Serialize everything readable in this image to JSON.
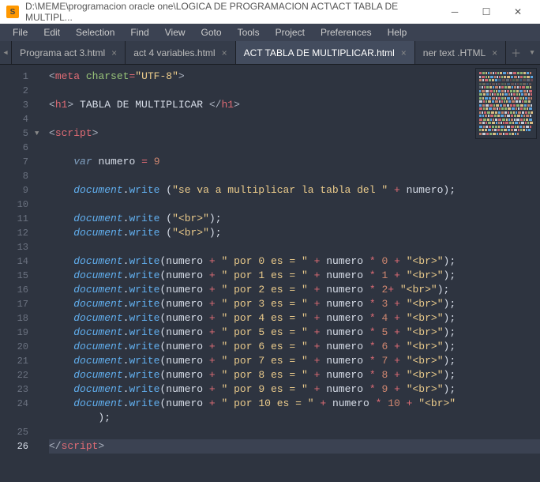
{
  "window": {
    "title": "D:\\MEME\\programacion oracle one\\LOGICA DE PROGRAMACION ACT\\ACT TABLA DE MULTIPL...",
    "app_icon_letter": "S"
  },
  "menu": {
    "items": [
      "File",
      "Edit",
      "Selection",
      "Find",
      "View",
      "Goto",
      "Tools",
      "Project",
      "Preferences",
      "Help"
    ]
  },
  "tabs": {
    "list": [
      {
        "label": "Programa act 3.html",
        "active": false
      },
      {
        "label": "act 4 variables.html",
        "active": false
      },
      {
        "label": "ACT TABLA DE MULTIPLICAR.html",
        "active": true
      },
      {
        "label": "ner text .HTML",
        "active": false
      }
    ]
  },
  "gutter": {
    "lines": [
      "1",
      "2",
      "3",
      "4",
      "5",
      "6",
      "7",
      "8",
      "9",
      "10",
      "11",
      "12",
      "13",
      "14",
      "15",
      "16",
      "17",
      "18",
      "19",
      "20",
      "21",
      "22",
      "23",
      "24",
      "",
      "25",
      "26"
    ],
    "fold_at": 5,
    "active": 26
  },
  "code": {
    "lines": [
      {
        "t": "meta",
        "tag": "meta",
        "attr": "charset",
        "str": "UTF-8"
      },
      {
        "t": "blank"
      },
      {
        "t": "h1",
        "text": " TABLA DE MULTIPLICAR "
      },
      {
        "t": "blank"
      },
      {
        "t": "open",
        "tag": "script"
      },
      {
        "t": "blank"
      },
      {
        "t": "var",
        "name": "numero",
        "val": "9"
      },
      {
        "t": "blank"
      },
      {
        "t": "dw_space",
        "str": "\"se va a multiplicar la tabla del \"",
        "tail": " + numero"
      },
      {
        "t": "blank"
      },
      {
        "t": "dw_space",
        "str": "\"<br>\"",
        "tail": ""
      },
      {
        "t": "dw_space",
        "str": "\"<br>\"",
        "tail": ""
      },
      {
        "t": "blank"
      },
      {
        "t": "mul",
        "n": "0",
        "trail": "+ \"<br>\""
      },
      {
        "t": "mul",
        "n": "1",
        "trail": "+ \"<br>\""
      },
      {
        "t": "mul2",
        "n": "2",
        "trail": "\"<br>\""
      },
      {
        "t": "mul",
        "n": "3",
        "trail": "+ \"<br>\""
      },
      {
        "t": "mul",
        "n": "4",
        "trail": "+ \"<br>\""
      },
      {
        "t": "mul",
        "n": "5",
        "trail": "+ \"<br>\""
      },
      {
        "t": "mul",
        "n": "6",
        "trail": "+ \"<br>\""
      },
      {
        "t": "mul",
        "n": "7",
        "trail": "+ \"<br>\""
      },
      {
        "t": "mul",
        "n": "8",
        "trail": "+ \"<br>\""
      },
      {
        "t": "mul",
        "n": "9",
        "trail": "+ \"<br>\""
      },
      {
        "t": "mul10"
      },
      {
        "t": "cont_paren"
      },
      {
        "t": "blank"
      },
      {
        "t": "close",
        "tag": "script"
      }
    ]
  }
}
